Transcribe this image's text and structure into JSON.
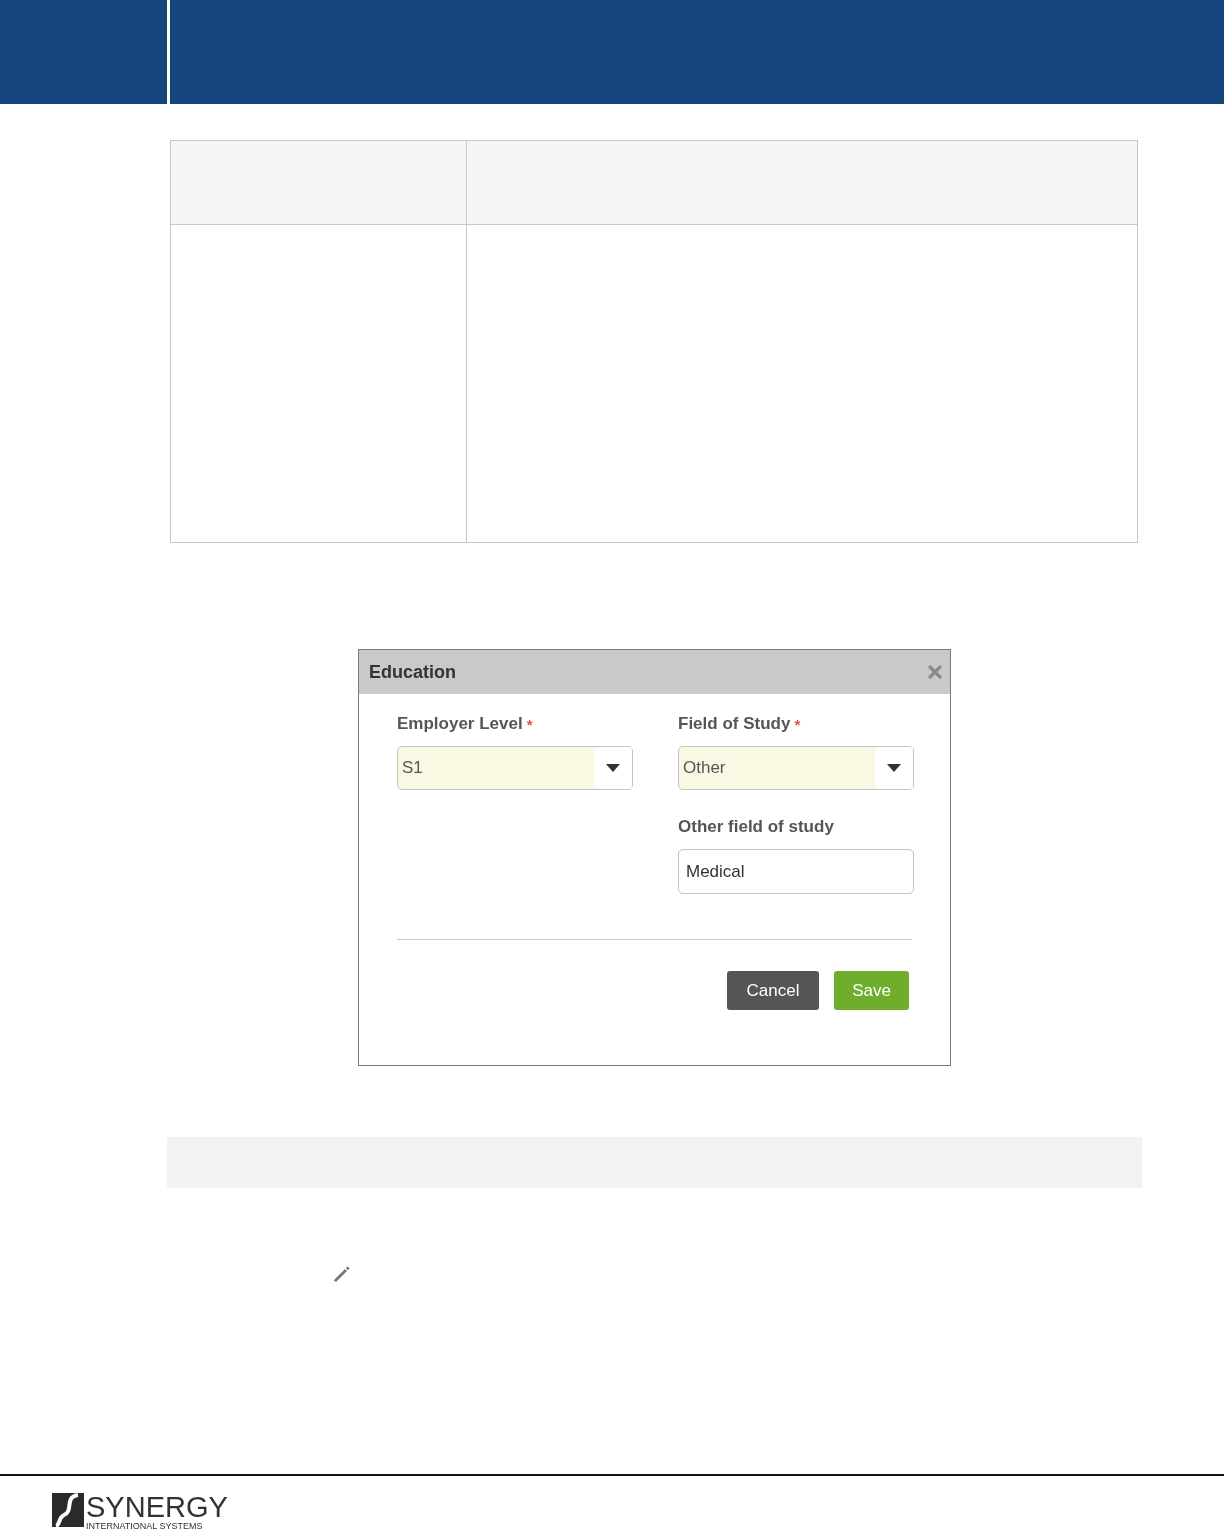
{
  "dialog": {
    "title": "Education",
    "fields": [
      {
        "kind": "select",
        "label": "Employer Level",
        "required_mark": "*",
        "value": "S1"
      },
      {
        "kind": "select",
        "label": "Field of Study",
        "required_mark": "*",
        "value": "Other"
      },
      {
        "kind": "text",
        "label": "Other field of study",
        "value": "Medical"
      }
    ],
    "buttons": [
      {
        "kind": "cancel",
        "label": "Cancel"
      },
      {
        "kind": "save",
        "label": "Save"
      }
    ]
  },
  "footer": {
    "logo": {
      "name": "SYNERGY",
      "tagline": "INTERNATIONAL SYSTEMS"
    }
  }
}
